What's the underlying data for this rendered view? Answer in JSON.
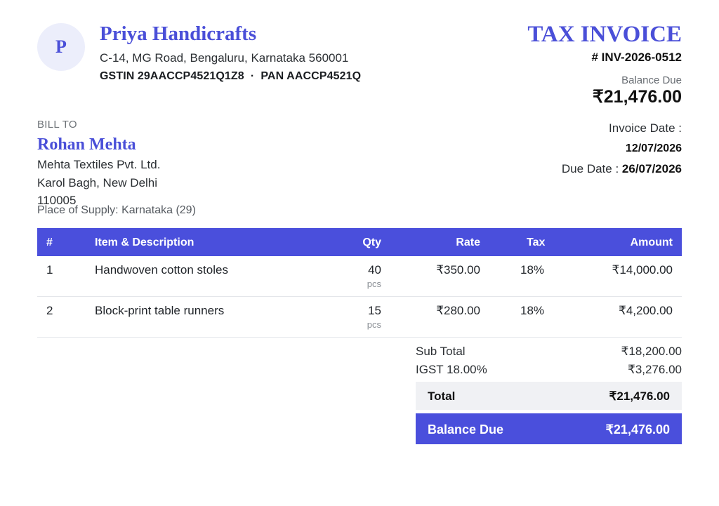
{
  "company": {
    "initial": "P",
    "name": "Priya Handicrafts",
    "address": "C-14, MG Road, Bengaluru, Karnataka 560001",
    "ids": "GSTIN 29AACCP4521Q1Z8  ·  PAN AACCP4521Q"
  },
  "invoice": {
    "title": "TAX INVOICE",
    "number": "# INV-2026-0512",
    "balance_label": "Balance Due",
    "balance_amount": "₹21,476.00",
    "date_label": "Invoice Date :",
    "date_value": "12/07/2026",
    "due_label": "Due Date : ",
    "due_value": "26/07/2026"
  },
  "bill_to": {
    "label": "BILL TO",
    "name": "Rohan Mehta",
    "company": "Mehta Textiles Pvt. Ltd.",
    "address_line1": "Karol Bagh, New Delhi",
    "address_line2": "110005",
    "place_of_supply": "Place of Supply: Karnataka (29)"
  },
  "table": {
    "headers": [
      "#",
      "Item & Description",
      "Qty",
      "Rate",
      "Tax",
      "Amount"
    ],
    "rows": [
      {
        "num": "1",
        "item": "Handwoven cotton stoles",
        "qty": "40",
        "unit": "pcs",
        "rate": "₹350.00",
        "tax": "18%",
        "amount": "₹14,000.00"
      },
      {
        "num": "2",
        "item": "Block-print table runners",
        "qty": "15",
        "unit": "pcs",
        "rate": "₹280.00",
        "tax": "18%",
        "amount": "₹4,200.00"
      }
    ]
  },
  "totals": {
    "sub_total_label": "Sub Total",
    "sub_total_value": "₹18,200.00",
    "tax_label": "IGST 18.00%",
    "tax_value": "₹3,276.00",
    "total_label": "Total",
    "total_value": "₹21,476.00",
    "balance_label": "Balance Due",
    "balance_value": "₹21,476.00"
  },
  "colors": {
    "accent": "#4a4fd8",
    "header_bg": "#4a4fdc",
    "total_bg": "#f0f1f4"
  }
}
